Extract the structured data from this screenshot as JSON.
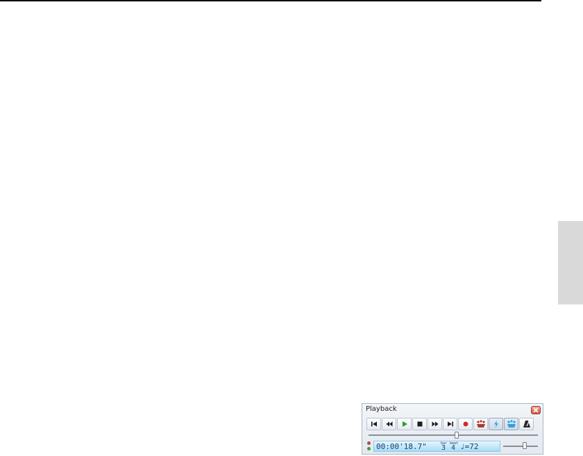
{
  "playback": {
    "title": "Playback",
    "position_fraction": 0.52,
    "volume_fraction": 0.62,
    "toolbar": [
      {
        "name": "rewind-to-start-button",
        "icon": "skip-to-start-icon"
      },
      {
        "name": "rewind-button",
        "icon": "rewind-icon"
      },
      {
        "name": "play-button",
        "icon": "play-icon"
      },
      {
        "name": "stop-button",
        "icon": "stop-icon"
      },
      {
        "name": "fast-forward-button",
        "icon": "fast-forward-icon"
      },
      {
        "name": "skip-to-end-button",
        "icon": "skip-to-end-icon"
      },
      {
        "name": "record-button",
        "icon": "record-icon"
      },
      {
        "name": "mute-ensemble-button",
        "icon": "ensemble-red-icon"
      },
      {
        "name": "live-playback-button",
        "icon": "lightning-icon"
      },
      {
        "name": "live-ensemble-button",
        "icon": "ensemble-blue-icon"
      },
      {
        "name": "metronome-button",
        "icon": "metronome-icon"
      }
    ],
    "display": {
      "time": "00:00'18.7\"",
      "bar_label": "bar",
      "bar": "3",
      "beat_label": "beat",
      "beat": "4",
      "tempo": "♩=72"
    },
    "colors": {
      "play": "#2e9a2e",
      "record": "#cc2a2a",
      "led_red": "#b94a3a",
      "led_green": "#3f9a3a",
      "display_text": "#143e72",
      "accent_blue": "#2aa3e0"
    }
  }
}
